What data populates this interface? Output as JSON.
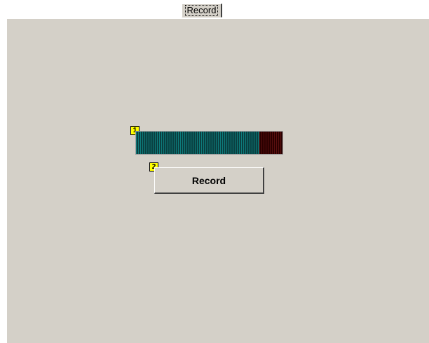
{
  "tab": {
    "label": "Record"
  },
  "meter": {
    "marker": "1",
    "level": 0.84
  },
  "record_button": {
    "marker": "2",
    "label": "Record"
  },
  "colors": {
    "panel": "#d4d0c8",
    "meter_lit": "#0e7c7c",
    "meter_peak": "#5a1010",
    "marker": "#ffff00"
  }
}
